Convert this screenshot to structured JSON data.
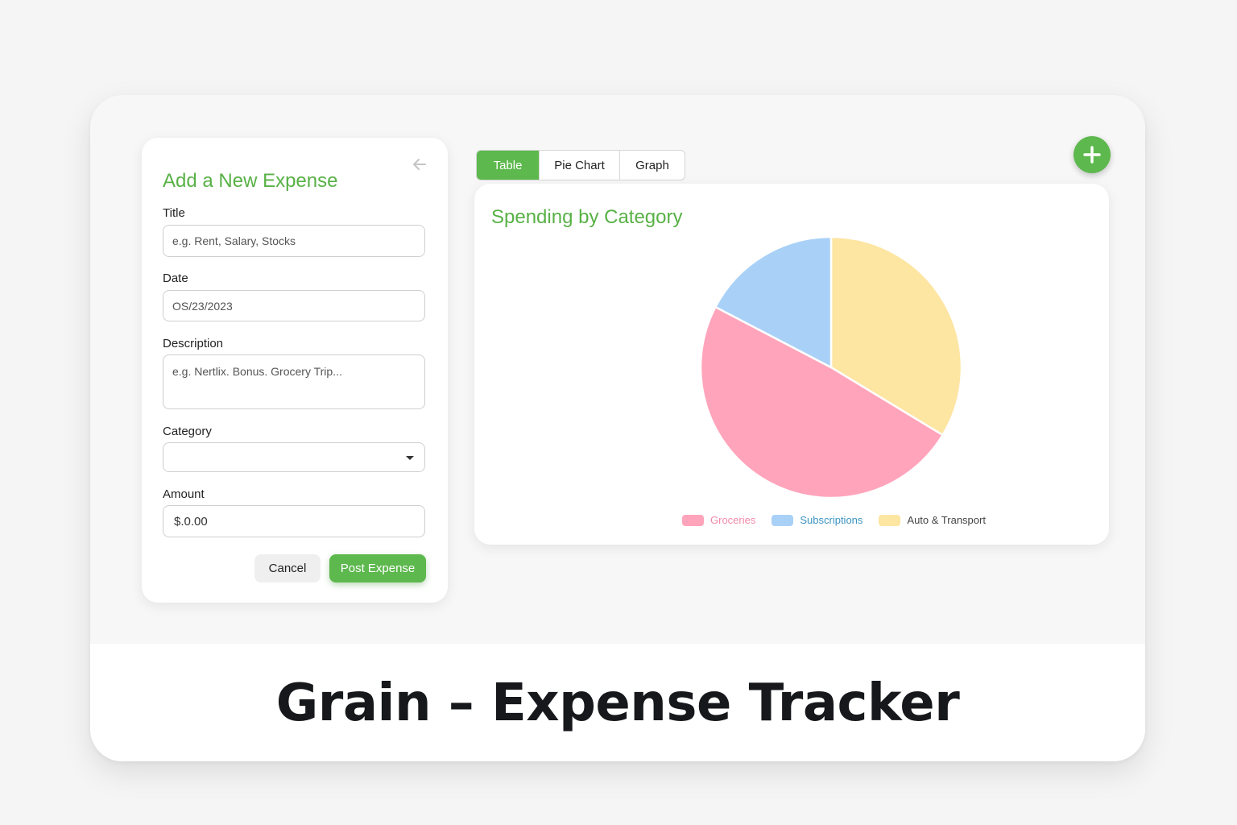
{
  "form": {
    "title": "Add a New Expense",
    "fields": {
      "title_label": "Title",
      "title_placeholder": "e.g. Rent, Salary, Stocks",
      "date_label": "Date",
      "date_value": "OS/23/2023",
      "description_label": "Description",
      "description_placeholder": "e.g. Nertlix. Bonus. Grocery Trip...",
      "category_label": "Category",
      "category_value": "",
      "amount_label": "Amount",
      "amount_value": "$.0.00"
    },
    "cancel_label": "Cancel",
    "post_label": "Post Expense"
  },
  "tabs": [
    {
      "label": "Table",
      "active": true
    },
    {
      "label": "Pie Chart",
      "active": false
    },
    {
      "label": "Graph",
      "active": false
    }
  ],
  "add_button": {
    "icon": "plus-icon"
  },
  "chart_data": {
    "type": "pie",
    "title": "Spending by Category",
    "slices": [
      {
        "label": "Groceries",
        "value": 48,
        "color": "#ffa4bb",
        "text_color": "#f08aa8"
      },
      {
        "label": "Subscriptions",
        "value": 17,
        "color": "#a9d1f7",
        "text_color": "#3b93c0"
      },
      {
        "label": "Auto & Transport",
        "value": 33,
        "color": "#fde5a2",
        "text_color": "#444444"
      }
    ],
    "legend_position": "bottom"
  },
  "caption": "Grain – Expense Tracker",
  "colors": {
    "brand_green": "#5db84d",
    "title_green": "#58b146"
  }
}
